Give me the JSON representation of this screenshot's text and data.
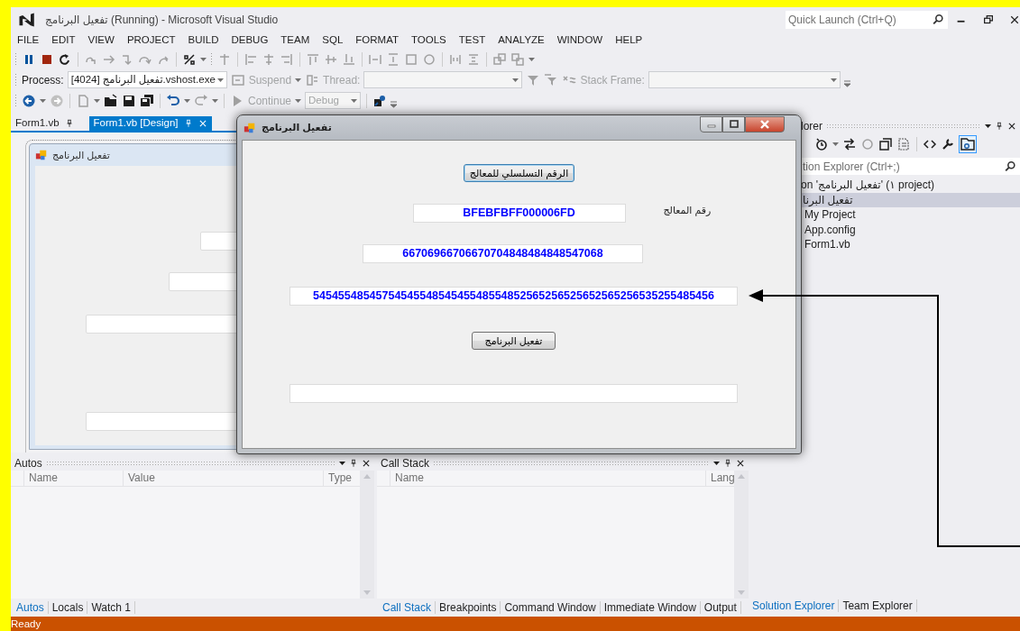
{
  "window": {
    "title": "تفعيل البرنامج (Running) - Microsoft Visual Studio",
    "quick_launch": {
      "placeholder": "Quick Launch (Ctrl+Q)"
    }
  },
  "menu": [
    "FILE",
    "EDIT",
    "VIEW",
    "PROJECT",
    "BUILD",
    "DEBUG",
    "TEAM",
    "SQL",
    "FORMAT",
    "TOOLS",
    "TEST",
    "ANALYZE",
    "WINDOW",
    "HELP"
  ],
  "debug_location_toolbar": {
    "process_label": "Process:",
    "process_value": "[4024] تفعيل البرنامج.vshost.exe",
    "suspend": "Suspend",
    "thread_label": "Thread:",
    "stack_frame_label": "Stack Frame:"
  },
  "standard_toolbar": {
    "continue": "Continue",
    "configuration": "Debug"
  },
  "document_tabs": [
    {
      "label": "Form1.vb",
      "selected": false
    },
    {
      "label": "Form1.vb [Design]",
      "selected": true
    }
  ],
  "designer": {
    "form_title": "تفعيل البرنامج"
  },
  "dialog": {
    "title": "تفعيل البرنامج",
    "serial_button": "الرقم التسلسلي للمعالج",
    "processor_label": "رقم المعالج",
    "processor_id": "BFEBFBFF000006FD",
    "code_field": "66706966706670704848484848547068",
    "key_field": "5454554854575454554854545548554852565256525652565256535255485456",
    "activate_button": "تفعيل البرنامج"
  },
  "solution_explorer": {
    "title": "lorer",
    "search": {
      "placeholder": "tion Explorer (Ctrl+;)"
    },
    "items": [
      {
        "label": "on 'تفعيل البرنامج' (١ project)",
        "selected": false,
        "children": [
          {
            "label": "تفعيل البرنا",
            "selected": true,
            "children": [
              {
                "label": "My Project",
                "selected": false
              },
              {
                "label": "App.config",
                "selected": false
              },
              {
                "label": "Form1.vb",
                "selected": false
              }
            ]
          }
        ]
      }
    ],
    "tabs": [
      {
        "label": "Solution Explorer",
        "selected": true
      },
      {
        "label": "Team Explorer",
        "selected": false
      }
    ]
  },
  "autos": {
    "title": "Autos",
    "columns": [
      "Name",
      "Value",
      "Type"
    ],
    "tabs": [
      {
        "label": "Autos",
        "selected": true
      },
      {
        "label": "Locals",
        "selected": false
      },
      {
        "label": "Watch 1",
        "selected": false
      }
    ]
  },
  "call_stack": {
    "title": "Call Stack",
    "columns": [
      "Name",
      "Lang"
    ],
    "tabs": [
      {
        "label": "Call Stack",
        "selected": true
      },
      {
        "label": "Breakpoints",
        "selected": false
      },
      {
        "label": "Command Window",
        "selected": false
      },
      {
        "label": "Immediate Window",
        "selected": false
      },
      {
        "label": "Output",
        "selected": false
      }
    ]
  },
  "status_bar": "Ready"
}
